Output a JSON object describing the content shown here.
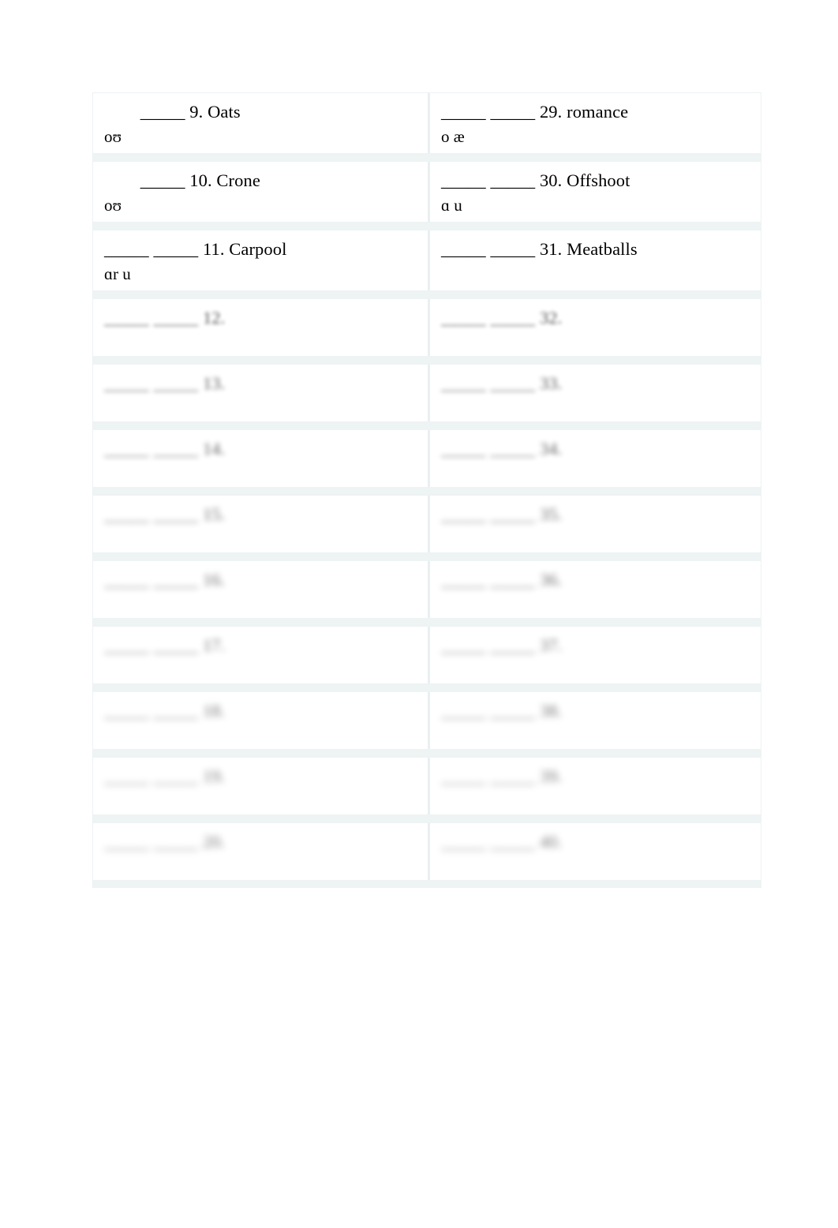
{
  "document": {
    "type": "phonetics-transcription-worksheet",
    "background_color": "#ffffff",
    "table_border_color": "#eef2f3",
    "row_separator_color": "#eef3f3",
    "text_color": "#000000"
  },
  "table": {
    "column_count": 2,
    "row_count": 14,
    "rows": [
      {
        "legible": true,
        "left": {
          "prompt": "        _____ 9. Oats",
          "ipa": "oʊ"
        },
        "right": {
          "prompt": "_____ _____ 29. romance",
          "ipa": "o æ"
        }
      },
      {
        "legible": true,
        "left": {
          "prompt": "        _____ 10. Crone",
          "ipa": "oʊ"
        },
        "right": {
          "prompt": "_____ _____ 30. Offshoot",
          "ipa": "ɑ u"
        }
      },
      {
        "legible": true,
        "left": {
          "prompt": "_____ _____ 11. Carpool",
          "ipa": "ɑr u"
        },
        "right": {
          "prompt": "_____ _____ 31. Meatballs",
          "ipa": ""
        }
      },
      {
        "legible": false,
        "blur": "b1",
        "left": {
          "prompt": "_____ _____ 12.",
          "ipa": ""
        },
        "right": {
          "prompt": "_____ _____ 32.",
          "ipa": ""
        }
      },
      {
        "legible": false,
        "blur": "b2",
        "left": {
          "prompt": "_____ _____ 13.",
          "ipa": ""
        },
        "right": {
          "prompt": "_____ _____ 33.",
          "ipa": ""
        }
      },
      {
        "legible": false,
        "blur": "b3",
        "left": {
          "prompt": "_____ _____ 14.",
          "ipa": ""
        },
        "right": {
          "prompt": "_____ _____ 34.",
          "ipa": ""
        }
      },
      {
        "legible": false,
        "blur": "b4",
        "left": {
          "prompt": "_____ _____ 15.",
          "ipa": ""
        },
        "right": {
          "prompt": "_____ _____ 35.",
          "ipa": ""
        }
      },
      {
        "legible": false,
        "blur": "b5",
        "left": {
          "prompt": "_____ _____ 16.",
          "ipa": ""
        },
        "right": {
          "prompt": "_____ _____ 36.",
          "ipa": ""
        }
      },
      {
        "legible": false,
        "blur": "b6",
        "left": {
          "prompt": "_____ _____ 17.",
          "ipa": ""
        },
        "right": {
          "prompt": "_____ _____ 37.",
          "ipa": ""
        }
      },
      {
        "legible": false,
        "blur": "b7",
        "left": {
          "prompt": "_____ _____ 18.",
          "ipa": ""
        },
        "right": {
          "prompt": "_____ _____ 38.",
          "ipa": ""
        }
      },
      {
        "legible": false,
        "blur": "b8",
        "left": {
          "prompt": "_____ _____ 19.",
          "ipa": ""
        },
        "right": {
          "prompt": "_____ _____ 39.",
          "ipa": ""
        }
      },
      {
        "legible": false,
        "blur": "b9",
        "left": {
          "prompt": "_____ _____ 20.",
          "ipa": ""
        },
        "right": {
          "prompt": "_____ _____ 40.",
          "ipa": ""
        }
      }
    ]
  }
}
